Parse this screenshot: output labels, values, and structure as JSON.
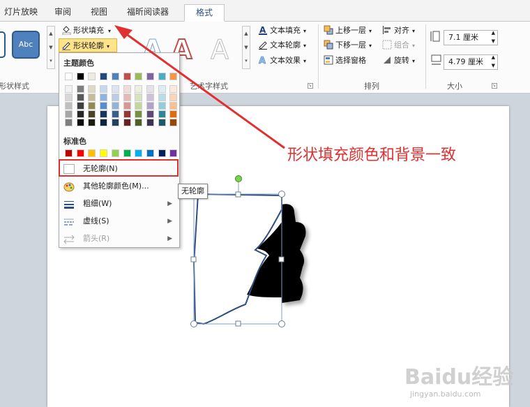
{
  "tabs": [
    "灯片放映",
    "审阅",
    "视图",
    "福昕阅读器",
    "格式"
  ],
  "ribbon": {
    "shape_styles_label": "形状样式",
    "shape_abc": "Abc",
    "shape_fill": "形状填充",
    "shape_outline": "形状轮廓",
    "wordart_label": "艺术字样式",
    "text_fill": "文本填充",
    "text_outline": "文本轮廓",
    "text_effect": "文本效果",
    "arrange_label": "排列",
    "bring_forward": "上移一层",
    "send_backward": "下移一层",
    "selection_pane": "选择窗格",
    "align": "对齐",
    "group": "组合",
    "rotate": "旋转",
    "size_label": "大小",
    "height_value": "7.1 厘米",
    "width_value": "4.79 厘米"
  },
  "menu": {
    "theme_colors_label": "主题颜色",
    "standard_colors_label": "标准色",
    "no_outline": "无轮廓(N)",
    "more_colors": "其他轮廓颜色(M)...",
    "weight": "粗细(W)",
    "dashes": "虚线(S)",
    "arrows": "箭头(R)",
    "theme_top_row": [
      "#ffffff",
      "#000000",
      "#eeece1",
      "#1f497d",
      "#4f81bd",
      "#c0504d",
      "#9bbb59",
      "#8064a2",
      "#4bacc6",
      "#f79646"
    ],
    "theme_shade_rows": [
      [
        "#f2f2f2",
        "#7f7f7f",
        "#ddd9c3",
        "#c6d9f0",
        "#dbe5f1",
        "#f2dcdb",
        "#ebf1dd",
        "#e5e0ec",
        "#dbeef3",
        "#fdeada"
      ],
      [
        "#d8d8d8",
        "#595959",
        "#c4bd97",
        "#8db3e2",
        "#b8cce4",
        "#e5b9b7",
        "#d7e3bc",
        "#ccc1d9",
        "#b7dde8",
        "#fbd5b5"
      ],
      [
        "#bfbfbf",
        "#3f3f3f",
        "#938953",
        "#548dd4",
        "#95b3d7",
        "#d99694",
        "#c3d69b",
        "#b2a2c7",
        "#92cddc",
        "#fac08f"
      ],
      [
        "#a5a5a5",
        "#262626",
        "#494429",
        "#17365d",
        "#366092",
        "#953734",
        "#76923c",
        "#5f497a",
        "#31859b",
        "#e36c09"
      ],
      [
        "#7f7f7f",
        "#0c0c0c",
        "#1d1b10",
        "#0f243e",
        "#244061",
        "#632423",
        "#4f6128",
        "#3f3151",
        "#205867",
        "#974806"
      ]
    ],
    "standard_row": [
      "#c00000",
      "#ff0000",
      "#ffc000",
      "#ffff00",
      "#92d050",
      "#00b050",
      "#00b0f0",
      "#0070c0",
      "#002060",
      "#7030a0"
    ]
  },
  "tooltip": "无轮廓",
  "annotation": "形状填充颜色和背景一致",
  "watermark": "Baidu经验",
  "watermark_url": "jingyan.baidu.com",
  "colors": {
    "highlight_red": "#e0302f",
    "accent_blue": "#2a4f8a"
  }
}
